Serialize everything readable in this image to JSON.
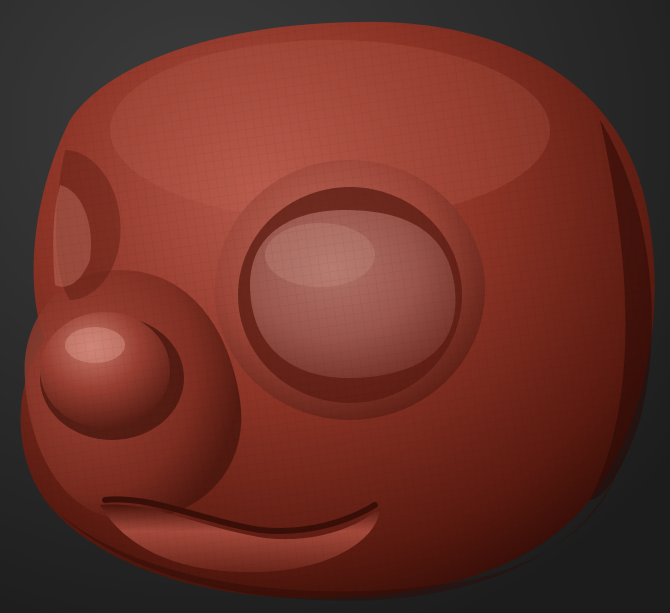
{
  "scene": {
    "subject": "sculpted-head-model",
    "colors": {
      "background_top": "#3a3a3a",
      "background_bottom": "#1e1e1e",
      "clay_base": "#8e3526",
      "clay_highlight": "#c87a6a",
      "clay_shadow": "#3d120b",
      "eye_socket_fill": "#a45f55"
    }
  }
}
